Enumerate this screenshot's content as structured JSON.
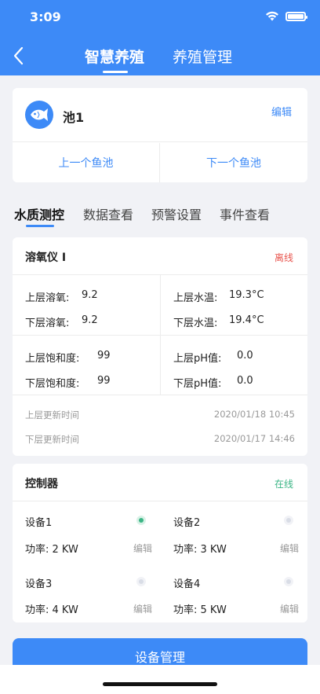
{
  "status": {
    "time": "3:09"
  },
  "nav": {
    "tabs": [
      "智慧养殖",
      "养殖管理"
    ]
  },
  "pond": {
    "name": "池1",
    "edit": "编辑",
    "prev": "上一个鱼池",
    "next": "下一个鱼池"
  },
  "sub_tabs": [
    "水质测控",
    "数据查看",
    "预警设置",
    "事件查看"
  ],
  "sensor": {
    "title": "溶氧仪 I",
    "state": "离线",
    "upper_do_label": "上层溶氧:",
    "upper_do_value": "9.2",
    "lower_do_label": "下层溶氧:",
    "lower_do_value": "9.2",
    "upper_temp_label": "上层水温:",
    "upper_temp_value": "19.3°C",
    "lower_temp_label": "下层水温:",
    "lower_temp_value": "19.4°C",
    "upper_sat_label": "上层饱和度:",
    "upper_sat_value": "99",
    "lower_sat_label": "下层饱和度:",
    "lower_sat_value": "99",
    "upper_ph_label": "上层pH值:",
    "upper_ph_value": "0.0",
    "lower_ph_label": "下层pH值:",
    "lower_ph_value": "0.0",
    "upper_update_label": "上层更新时间",
    "upper_update_value": "2020/01/18 10:45",
    "lower_update_label": "下层更新时间",
    "lower_update_value": "2020/01/17 14:46"
  },
  "controller": {
    "title": "控制器",
    "state": "在线",
    "devices": [
      {
        "name": "设备1",
        "power": "功率: 2 KW",
        "edit": "编辑",
        "on": true
      },
      {
        "name": "设备2",
        "power": "功率: 3 KW",
        "edit": "编辑",
        "on": false
      },
      {
        "name": "设备3",
        "power": "功率: 4 KW",
        "edit": "编辑",
        "on": false
      },
      {
        "name": "设备4",
        "power": "功率: 5 KW",
        "edit": "编辑",
        "on": false
      }
    ]
  },
  "manage_button": "设备管理",
  "colors": {
    "primary": "#3d8af7",
    "offline": "#e8554e",
    "online": "#3bb585"
  },
  "icons": [
    "back-chevron-icon",
    "wifi-icon",
    "battery-icon",
    "fish-icon",
    "status-dot-icon"
  ]
}
